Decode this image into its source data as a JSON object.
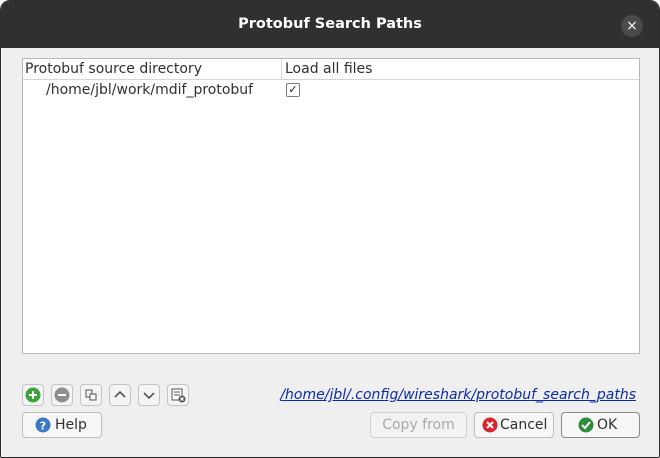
{
  "window": {
    "title": "Protobuf Search Paths",
    "close_glyph": "×"
  },
  "table": {
    "headers": [
      "Protobuf source directory",
      "Load all files"
    ],
    "rows": [
      {
        "directory": "/home/jbl/work/mdif_protobuf",
        "load_all": true,
        "check_glyph": "✓"
      }
    ]
  },
  "toolbar": {
    "icons": [
      "add-icon",
      "remove-icon",
      "copy-icon",
      "move-up-icon",
      "move-down-icon",
      "clear-icon"
    ],
    "config_path": "/home/jbl/.config/wireshark/protobuf_search_paths"
  },
  "buttons": {
    "help": "Help",
    "copy_from": "Copy from",
    "cancel": "Cancel",
    "ok": "OK"
  },
  "colors": {
    "titlebar": "#303030",
    "add_green": "#3aa33a",
    "link_blue": "#0b2aa8",
    "cancel_red": "#d9262c",
    "ok_green": "#2e8b3a"
  }
}
